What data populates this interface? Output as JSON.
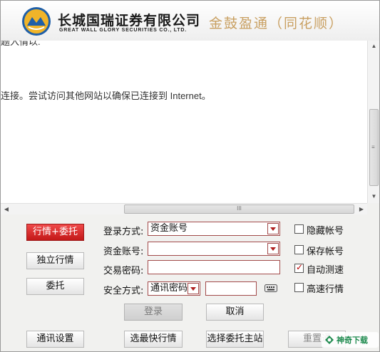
{
  "header": {
    "brand_cn": "长城国瑞证券有限公司",
    "brand_en": "GREAT WALL GLORY SECURITIES CO., LTD.",
    "product": "金鼓盈通（同花顺）"
  },
  "browser": {
    "top_text_fragment": "题入情以.",
    "message": "连接。尝试访问其他网站以确保已连接到 Internet。",
    "hscroll_grip": "III",
    "vscroll_grip": "≡"
  },
  "left_buttons": {
    "market_trade": "行情+委托",
    "market_only": "独立行情",
    "trade_only": "委托"
  },
  "form": {
    "login_method_label": "登录方式:",
    "login_method_value": "资金账号",
    "account_label": "资金账号:",
    "account_value": "",
    "password_label": "交易密码:",
    "password_value": "",
    "security_label": "安全方式:",
    "security_method_value": "通讯密码",
    "security_password_value": ""
  },
  "options": {
    "hide_account": {
      "label": "隐藏帐号",
      "checked": false
    },
    "save_account": {
      "label": "保存帐号",
      "checked": false
    },
    "auto_speedtest": {
      "label": "自动测速",
      "checked": true
    },
    "fast_market": {
      "label": "高速行情",
      "checked": false
    }
  },
  "actions": {
    "login": "登录",
    "cancel": "取消"
  },
  "bottom_buttons": {
    "comm_settings": "通讯设置",
    "fastest_market": "选最快行情",
    "select_trade_server": "选择委托主站",
    "reset_comm": "重置通"
  },
  "watermark": {
    "text": "神奇下载"
  },
  "colors": {
    "accent_red": "#c31818",
    "product_gold": "#c9a062",
    "watermark_green": "#1e8a4e"
  }
}
